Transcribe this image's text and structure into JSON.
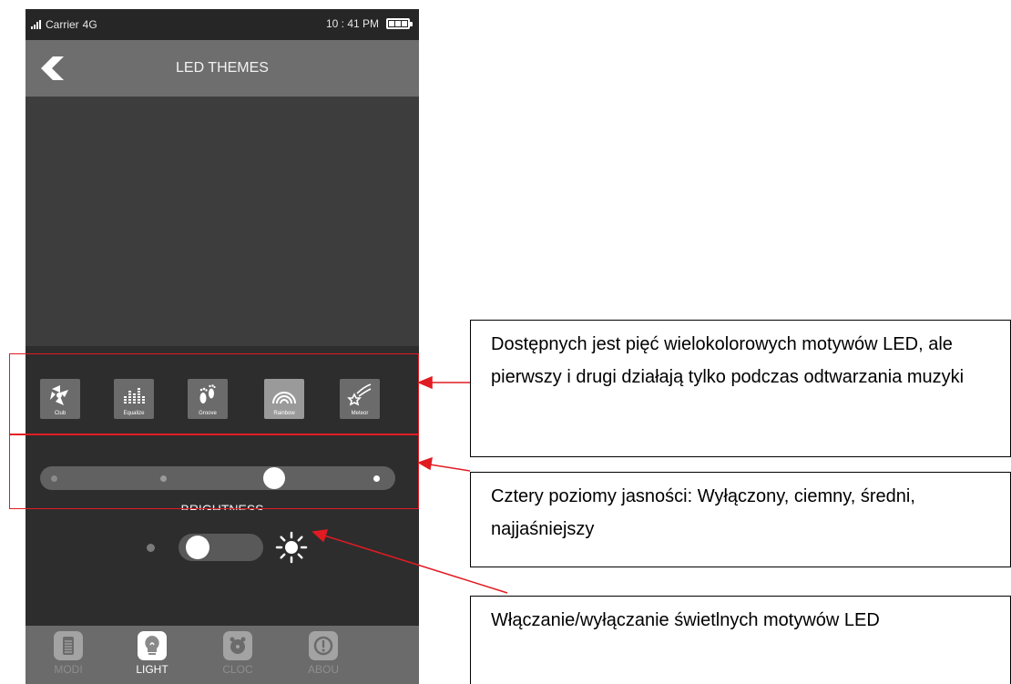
{
  "status": {
    "carrier": "Carrier",
    "network": "4G",
    "time": "10 : 41 PM"
  },
  "header": {
    "title": "LED THEMES",
    "back_icon": "chevron-left-icon"
  },
  "themes": [
    {
      "label": "Club",
      "icon": "club-icon",
      "selected": false
    },
    {
      "label": "Equalize",
      "icon": "equalizer-icon",
      "selected": false
    },
    {
      "label": "Groove",
      "icon": "footprints-icon",
      "selected": false
    },
    {
      "label": "Rainbow",
      "icon": "rainbow-icon",
      "selected": true
    },
    {
      "label": "Meteor",
      "icon": "meteor-icon",
      "selected": false
    }
  ],
  "brightness": {
    "label": "BRIGHTNESS",
    "levels": 4,
    "selected_level_index": 2
  },
  "led_toggle": {
    "on": false
  },
  "tabs": [
    {
      "label": "MODI",
      "icon": "document-icon",
      "active": false
    },
    {
      "label": "LIGHT",
      "icon": "bulb-icon",
      "active": true
    },
    {
      "label": "CLOC",
      "icon": "alarm-clock-icon",
      "active": false
    },
    {
      "label": "ABOU",
      "icon": "info-icon",
      "active": false
    }
  ],
  "callouts": {
    "themes": "Dostępnych jest pięć wielokolorowych motywów LED, ale pierwszy i drugi działają tylko podczas odtwarzania muzyki",
    "brightness": "Cztery poziomy jasności: Wyłączony, ciemny, średni, najjaśniejszy",
    "toggle": "Włączanie/wyłączanie świetlnych motywów LED"
  },
  "colors": {
    "annotation_red": "#e11b22",
    "panel_dark": "#2d2d2d",
    "nav_gray": "#6e6e6e"
  }
}
